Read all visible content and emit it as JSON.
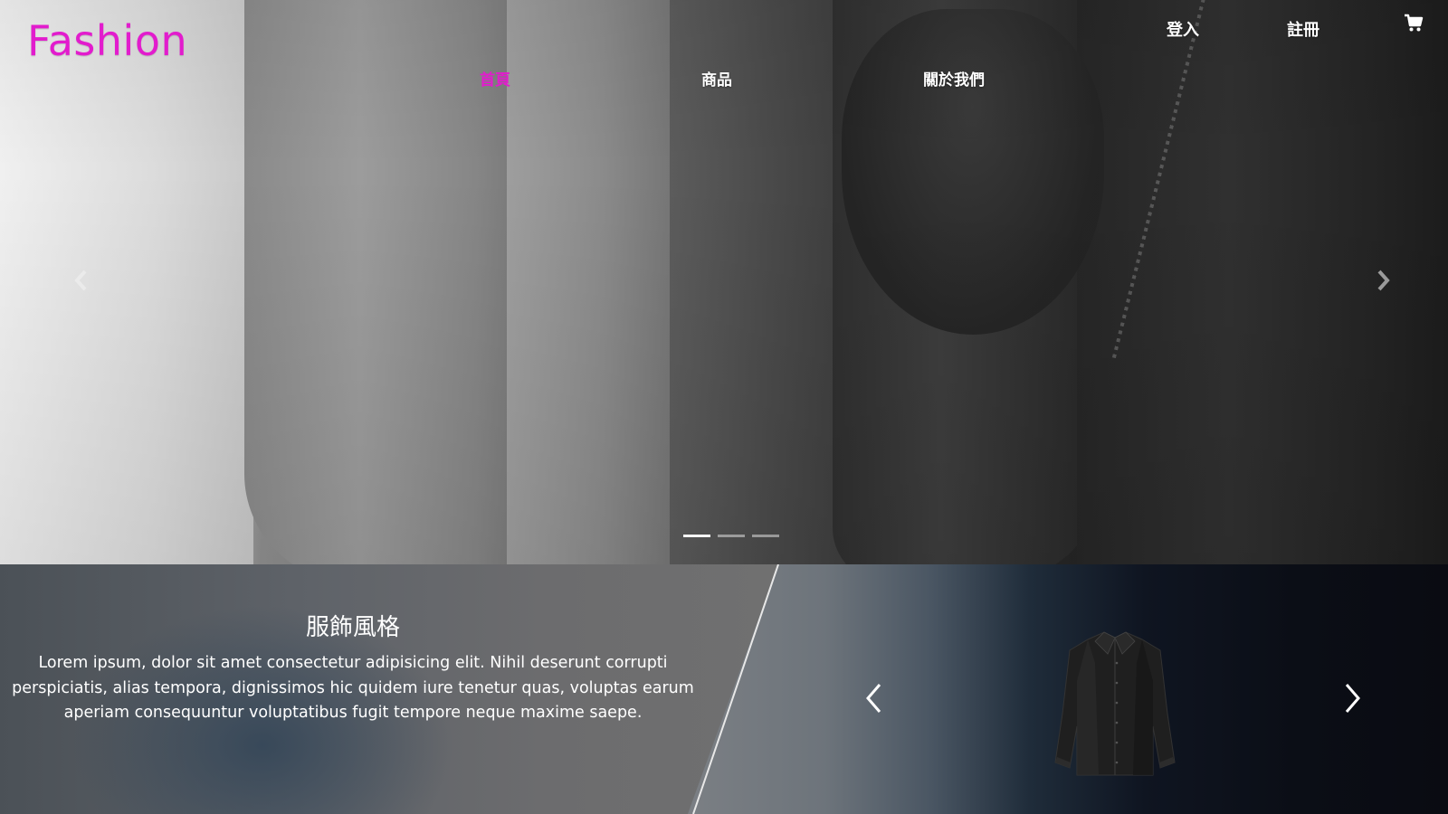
{
  "header": {
    "logo": "Fashion",
    "login_label": "登入",
    "register_label": "註冊",
    "cart_icon": "shopping-cart-icon",
    "accent_color": "#e21ccd"
  },
  "nav": {
    "items": [
      {
        "label": "首頁",
        "active": true
      },
      {
        "label": "商品",
        "active": false
      },
      {
        "label": "關於我們",
        "active": false
      }
    ]
  },
  "hero": {
    "prev_icon": "chevron-left-icon",
    "next_icon": "chevron-right-icon",
    "slide_count": 3,
    "active_slide": 1
  },
  "style_section": {
    "title": "服飾風格",
    "text": "Lorem ipsum, dolor sit amet consectetur adipisicing elit. Nihil deserunt corrupti perspiciatis, alias tempora, dignissimos hic quidem iure tenetur quas, voluptas earum aperiam consequuntur voluptatibus fugit tempore neque maxime saepe."
  },
  "product_carousel": {
    "prev_icon": "chevron-left-icon",
    "next_icon": "chevron-right-icon",
    "product_image": "black-shirt-image"
  }
}
